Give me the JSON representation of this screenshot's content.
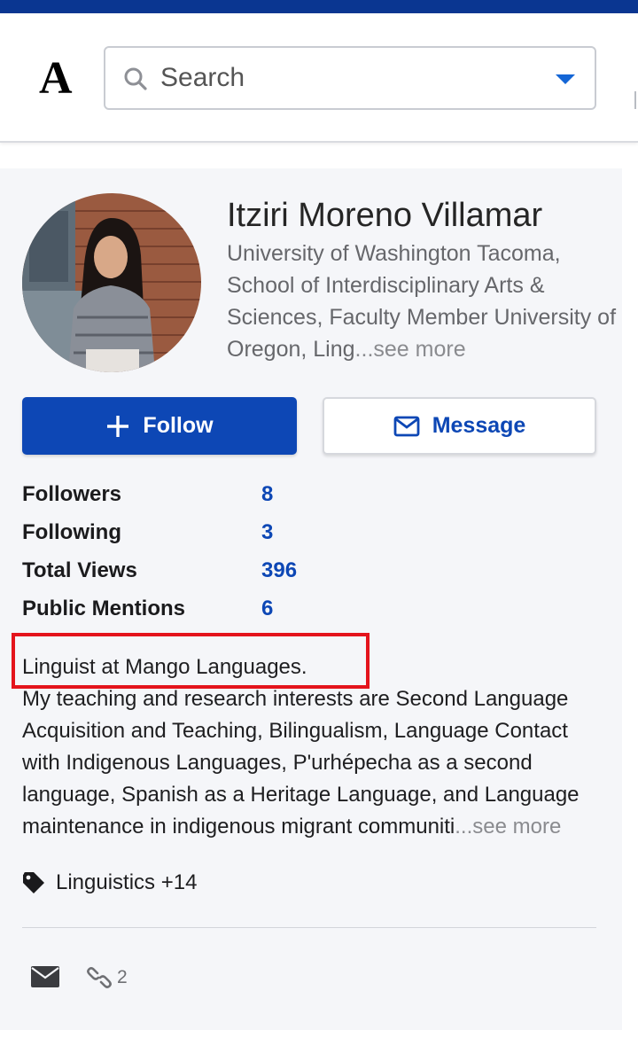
{
  "header": {
    "logo_letter": "A",
    "search_placeholder": "Search",
    "accent_color": "#0d47b5",
    "top_strip_color": "#0a3691"
  },
  "profile": {
    "name": "Itziri Moreno Villamar",
    "affiliation_main": "University of Washington Tacoma, School of Interdisciplinary Arts & Sciences, Faculty Member University of Oregon, Ling",
    "affiliation_suffix": "...see more",
    "avatar_alt": "Profile photo"
  },
  "actions": {
    "follow_label": "Follow",
    "follow_icon": "plus-icon",
    "message_label": "Message",
    "message_icon": "envelope-outline-icon"
  },
  "stats": [
    {
      "label": "Followers",
      "value": "8"
    },
    {
      "label": "Following",
      "value": "3"
    },
    {
      "label": "Total Views",
      "value": "396"
    },
    {
      "label": "Public Mentions",
      "value": "6"
    }
  ],
  "bio": {
    "headline": "Linguist at Mango Languages.",
    "body": "My teaching and research interests are Second Language Acquisition and Teaching, Bilingualism, Language Contact with Indigenous Languages, P'urhépecha as a second language, Spanish as a Heritage Language, and Language maintenance in indigenous migrant communiti",
    "suffix": "...see more",
    "highlight_color": "#e4141c"
  },
  "tags": {
    "icon": "tag-icon",
    "label": "Linguistics +14"
  },
  "footer": {
    "mail_icon": "envelope-filled-icon",
    "link_icon": "chain-link-icon",
    "link_count": "2"
  }
}
